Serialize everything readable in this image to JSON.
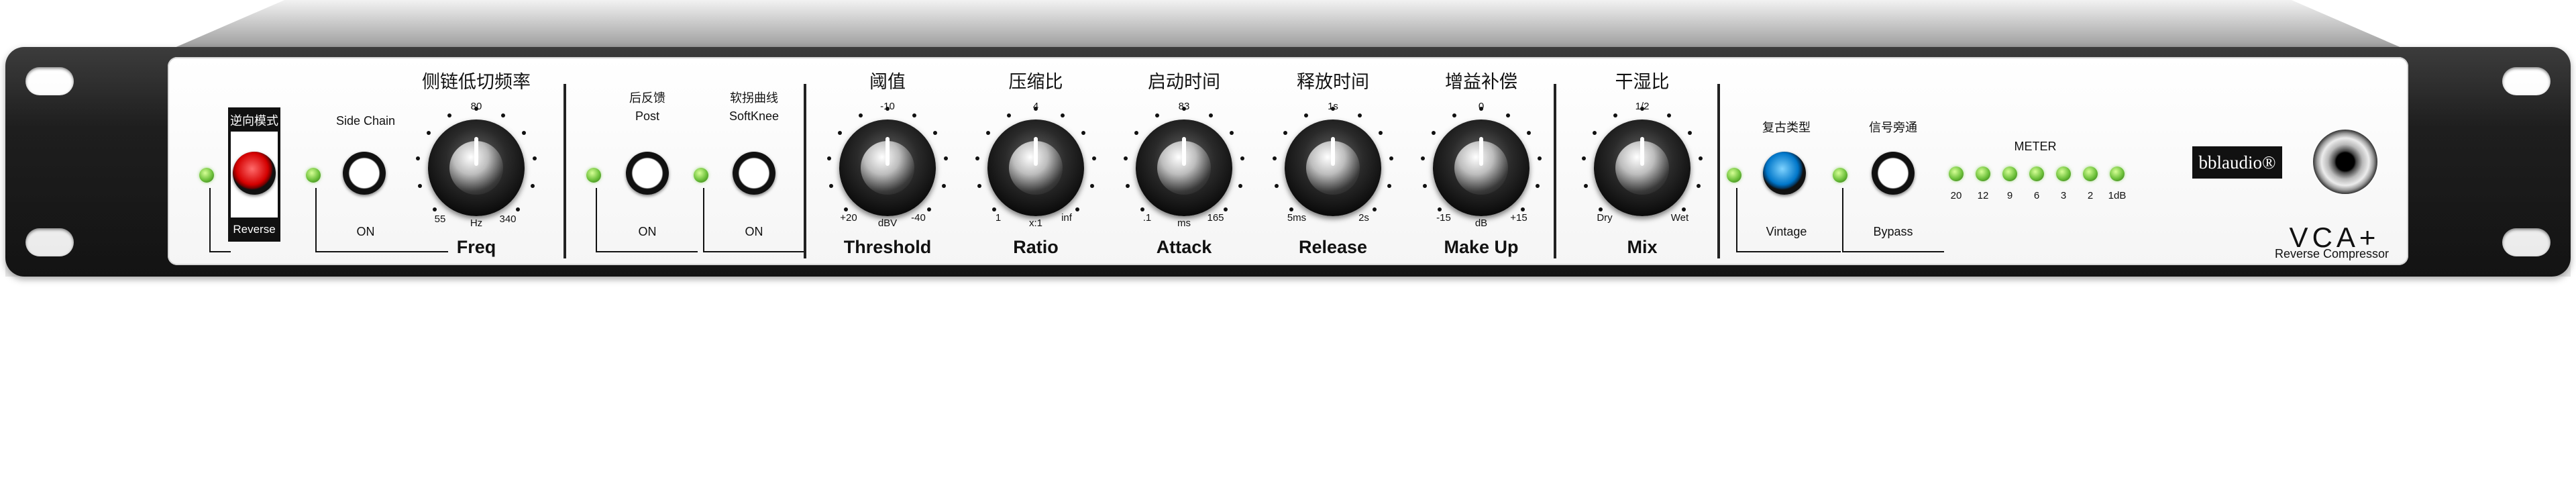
{
  "brand": {
    "logo_text": "bblaudio®",
    "model": "VCA+",
    "subtitle": "Reverse Compressor"
  },
  "reverse_mode": {
    "cn": "逆向模式",
    "en": "Reverse"
  },
  "side_chain": {
    "label": "Side Chain",
    "on": "ON"
  },
  "freq": {
    "cn": "侧链低切频率",
    "en": "Freq",
    "top": "80",
    "min": "55",
    "unit": "Hz",
    "max": "340"
  },
  "post": {
    "cn": "后反馈",
    "en": "Post",
    "on": "ON"
  },
  "softknee": {
    "cn": "软拐曲线",
    "en": "SoftKnee",
    "on": "ON"
  },
  "threshold": {
    "cn": "阈值",
    "en": "Threshold",
    "top": "-10",
    "min": "+20",
    "unit": "dBV",
    "max": "-40"
  },
  "ratio": {
    "cn": "压缩比",
    "en": "Ratio",
    "top": "4",
    "min": "1",
    "unit": "x:1",
    "max": "inf"
  },
  "attack": {
    "cn": "启动时间",
    "en": "Attack",
    "top": "83",
    "min": ".1",
    "unit": "ms",
    "max": "165"
  },
  "release": {
    "cn": "释放时间",
    "en": "Release",
    "top": "1s",
    "min": "5ms",
    "unit": "",
    "max": "2s"
  },
  "makeup": {
    "cn": "增益补偿",
    "en": "Make Up",
    "top": "0",
    "min": "-15",
    "unit": "dB",
    "max": "+15"
  },
  "mix": {
    "cn": "干湿比",
    "en": "Mix",
    "top": "1/2",
    "min": "Dry",
    "unit": "",
    "max": "Wet"
  },
  "vintage": {
    "cn": "复古类型",
    "en": "Vintage"
  },
  "bypass": {
    "cn": "信号旁通",
    "en": "Bypass"
  },
  "meter": {
    "title": "METER",
    "scale": [
      "20",
      "12",
      "9",
      "6",
      "3",
      "2",
      "1dB"
    ]
  },
  "colors": {
    "led": "#6cc03a",
    "reverse_button": "#d40000",
    "vintage_button": "#0076c9",
    "panel": "#ffffff",
    "chassis": "#1f1f1f"
  }
}
